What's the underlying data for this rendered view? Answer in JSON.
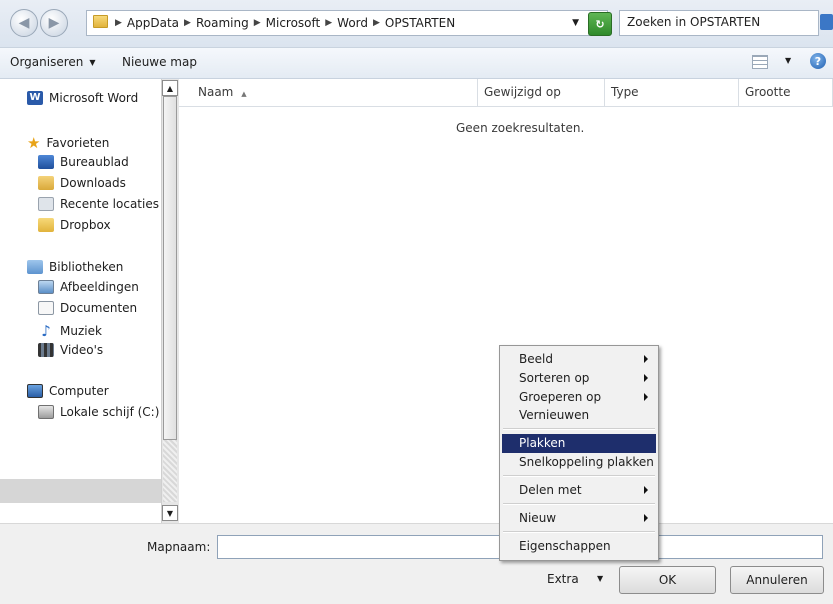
{
  "address": {
    "crumbs": [
      "AppData",
      "Roaming",
      "Microsoft",
      "Word",
      "OPSTARTEN"
    ],
    "search_placeholder": "Zoeken in OPSTARTEN"
  },
  "toolbar": {
    "organize": "Organiseren",
    "new_folder": "Nieuwe map"
  },
  "nav": {
    "word": "Microsoft Word",
    "favorites": "Favorieten",
    "desktop": "Bureaublad",
    "downloads": "Downloads",
    "recent": "Recente locaties",
    "dropbox": "Dropbox",
    "libraries": "Bibliotheken",
    "pictures": "Afbeeldingen",
    "documents": "Documenten",
    "music": "Muziek",
    "videos": "Video's",
    "computer": "Computer",
    "local_disk": "Lokale schijf (C:)"
  },
  "columns": {
    "name": "Naam",
    "modified": "Gewijzigd op",
    "type": "Type",
    "size": "Grootte"
  },
  "empty_message": "Geen zoekresultaten.",
  "bottom": {
    "folder_label": "Mapnaam:",
    "folder_value": "",
    "extra": "Extra",
    "ok": "OK",
    "cancel": "Annuleren"
  },
  "context_menu": {
    "view": "Beeld",
    "sort_by": "Sorteren op",
    "group_by": "Groeperen op",
    "refresh": "Vernieuwen",
    "paste": "Plakken",
    "paste_shortcut": "Snelkoppeling plakken",
    "share_with": "Delen met",
    "new": "Nieuw",
    "properties": "Eigenschappen"
  },
  "colors": {
    "menu_highlight": "#1e2e6c",
    "selected_nav": "#d6d6d6"
  }
}
